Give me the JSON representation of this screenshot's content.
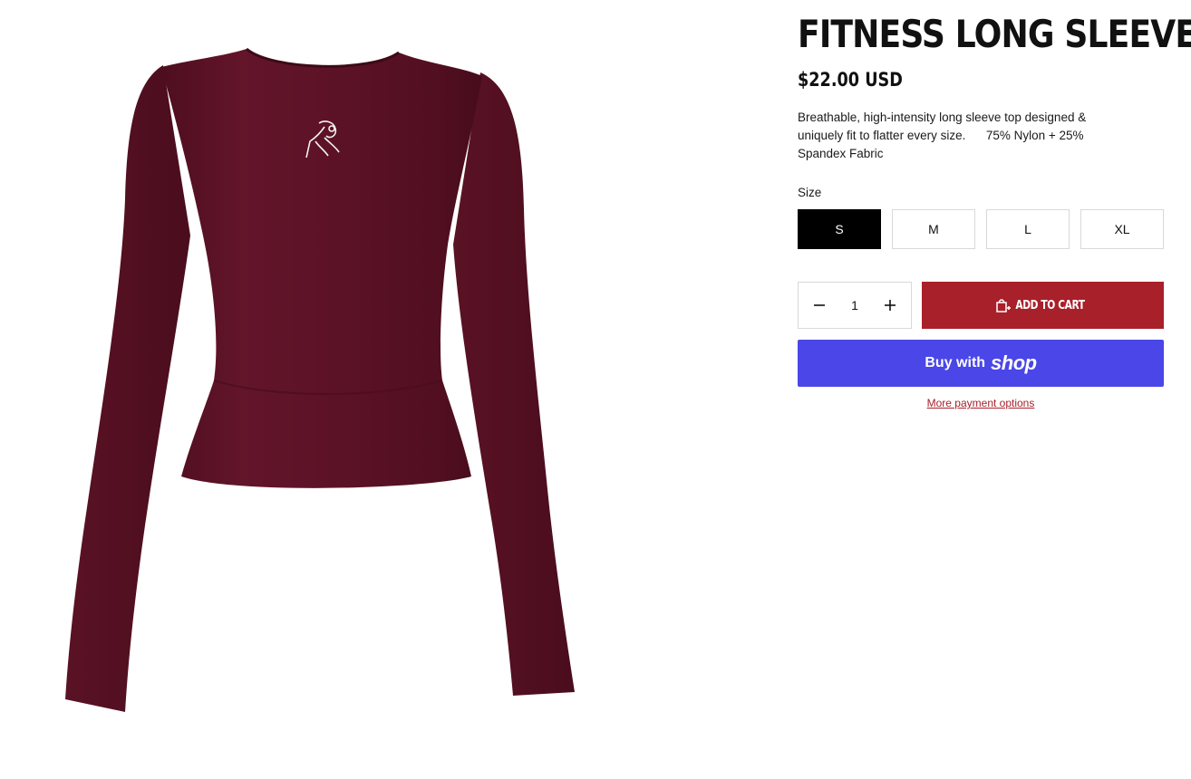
{
  "product": {
    "title": "FITNESS LONG SLEEVE",
    "price": "$22.00 USD",
    "description": "Breathable, high-intensity long sleeve top designed &\nuniquely fit to flatter every size.      75% Nylon + 25%\nSpandex Fabric",
    "image_icon": "long-sleeve-top-image",
    "shirt_color": "#5e1226"
  },
  "size_selector": {
    "label": "Size",
    "options": [
      "S",
      "M",
      "L",
      "XL"
    ],
    "selected": "S"
  },
  "quantity": {
    "value": "1",
    "minus_icon": "minus-icon",
    "plus_icon": "plus-icon"
  },
  "add_to_cart": {
    "label": "ADD TO CART",
    "icon": "cart-icon",
    "color": "#a8202a"
  },
  "buy_with_shop": {
    "label": "Buy with",
    "brand": "shop",
    "color": "#4a46e8"
  },
  "more_payment_options": {
    "label": "More payment options"
  }
}
